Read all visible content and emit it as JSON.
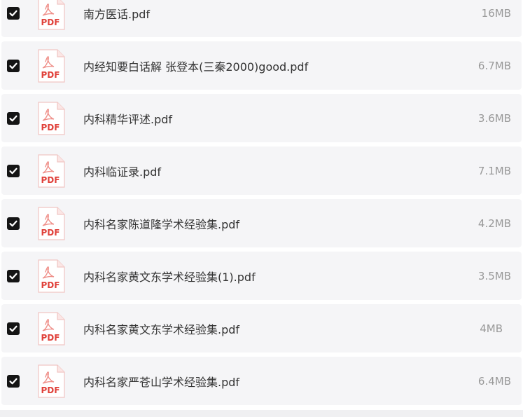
{
  "files": [
    {
      "name": "南方医话.pdf",
      "size": "16MB",
      "checked": true,
      "icon": "pdf-icon"
    },
    {
      "name": "内经知要白话解 张登本(三秦2000)good.pdf",
      "size": "6.7MB",
      "checked": true,
      "icon": "pdf-icon"
    },
    {
      "name": "内科精华评述.pdf",
      "size": "3.6MB",
      "checked": true,
      "icon": "pdf-icon"
    },
    {
      "name": "内科临证录.pdf",
      "size": "7.1MB",
      "checked": true,
      "icon": "pdf-icon"
    },
    {
      "name": "内科名家陈道隆学术经验集.pdf",
      "size": "4.2MB",
      "checked": true,
      "icon": "pdf-icon"
    },
    {
      "name": "内科名家黄文东学术经验集(1).pdf",
      "size": "3.5MB",
      "checked": true,
      "icon": "pdf-icon"
    },
    {
      "name": "内科名家黄文东学术经验集.pdf",
      "size": "4MB",
      "checked": true,
      "icon": "pdf-icon"
    },
    {
      "name": "内科名家严苍山学术经验集.pdf",
      "size": "6.4MB",
      "checked": true,
      "icon": "pdf-icon"
    }
  ],
  "pdf_label": "PDF",
  "colors": {
    "row_background": "#f5f5f7",
    "checkbox": "#151515",
    "pdf_red": "#e0413a",
    "name_text": "#333333",
    "size_text": "#999999"
  }
}
